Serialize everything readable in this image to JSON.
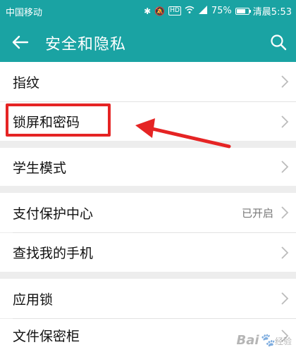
{
  "status_bar": {
    "carrier": "中国移动",
    "battery": "75%",
    "battery_level": 0.75,
    "clock": "清晨5:53",
    "hd_badge": "HD"
  },
  "header": {
    "title": "安全和隐私"
  },
  "rows": {
    "fingerprint": {
      "label": "指纹"
    },
    "lock_screen": {
      "label": "锁屏和密码"
    },
    "student_mode": {
      "label": "学生模式"
    },
    "payment_protection": {
      "label": "支付保护中心",
      "status": "已开启"
    },
    "find_my_phone": {
      "label": "查找我的手机"
    },
    "app_lock": {
      "label": "应用锁"
    },
    "file_safe": {
      "label": "文件保密柜"
    }
  },
  "annotation": {
    "highlight_color": "#e52424",
    "highlighted_item": "锁屏和密码"
  },
  "watermark": {
    "brand": "Bai",
    "suffix": "经验"
  },
  "colors": {
    "accent": "#1aa3a3",
    "background": "#ededed",
    "row_background": "#ffffff"
  },
  "icons": [
    "back-arrow-icon",
    "search-icon",
    "chevron-right-icon",
    "bluetooth-icon",
    "mute-icon",
    "wifi-icon",
    "signal-icon",
    "battery-icon"
  ]
}
